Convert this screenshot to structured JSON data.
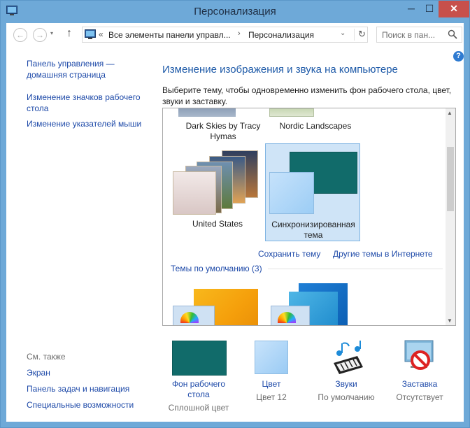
{
  "window": {
    "title": "Персонализация",
    "minimize": "─",
    "maximize": "☐",
    "close": "✕"
  },
  "nav": {
    "back": "←",
    "forward": "→",
    "up": "↑",
    "breadcrumb": [
      "Все элементы панели управл...",
      "Персонализация"
    ],
    "breadcrumb_prefix": "«",
    "breadcrumb_separator": "›",
    "refresh": "↻",
    "dropdown": "⌄",
    "search_placeholder": "Поиск в пан..."
  },
  "help": "?",
  "sidebar": {
    "links": [
      "Панель управления —",
      "домашняя страница",
      "Изменение значков рабочего",
      "стола",
      "Изменение указателей мыши"
    ],
    "see_also_label": "См. также",
    "see_also": [
      "Экран",
      "Панель задач и навигация",
      "Специальные возможности"
    ]
  },
  "main": {
    "heading": "Изменение изображения и звука на компьютере",
    "description": "Выберите тему, чтобы одновременно изменить фон рабочего стола, цвет, звуки и заставку.",
    "themes_top": [
      {
        "label_line1": "Dark Skies by Tracy",
        "label_line2": "Hymas"
      },
      {
        "label_line1": "Nordic Landscapes",
        "label_line2": ""
      }
    ],
    "themes_mid": [
      {
        "label_line1": "United States",
        "label_line2": ""
      },
      {
        "label_line1": "Синхронизированная",
        "label_line2": "тема",
        "selected": true
      }
    ],
    "save_theme": "Сохранить тему",
    "more_themes": "Другие темы в Интернете",
    "default_group": "Темы по умолчанию (3)"
  },
  "bottom": [
    {
      "label_line1": "Фон рабочего",
      "label_line2": "стола",
      "value": "Сплошной цвет",
      "icon": "solid-color-wallpaper-icon"
    },
    {
      "label_line1": "Цвет",
      "label_line2": "",
      "value": "Цвет 12",
      "icon": "window-color-icon"
    },
    {
      "label_line1": "Звуки",
      "label_line2": "",
      "value": "По умолчанию",
      "icon": "sounds-icon"
    },
    {
      "label_line1": "Заставка",
      "label_line2": "",
      "value": "Отсутствует",
      "icon": "screensaver-icon"
    }
  ],
  "colors": {
    "titlebar": "#6ea9d8",
    "link": "#1d49a8",
    "heading": "#1e5aa8",
    "sync_theme_dark": "#116b6a",
    "selection": "#cfe4f7"
  }
}
